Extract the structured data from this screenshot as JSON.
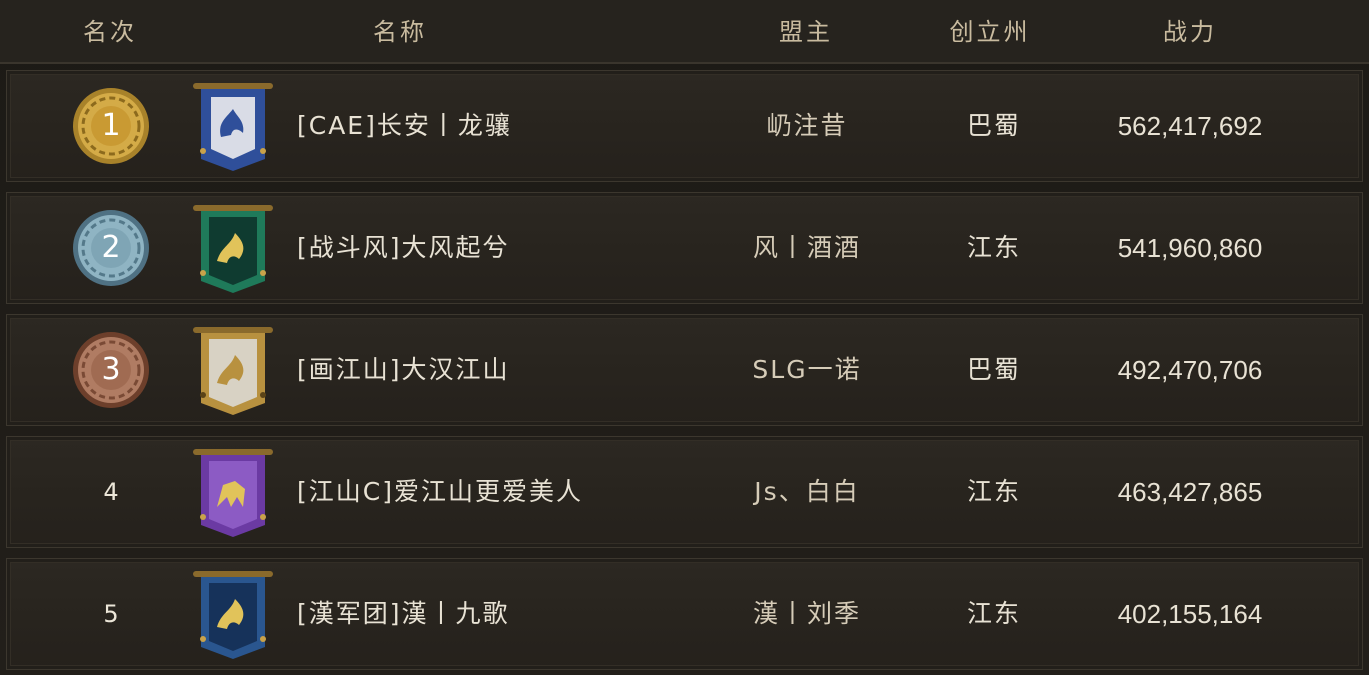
{
  "header": {
    "rank": "名次",
    "name": "名称",
    "leader": "盟主",
    "state": "创立州",
    "power": "战力"
  },
  "rows": [
    {
      "rank": "1",
      "name": "[CAE]长安丨龙骧",
      "leader": "屷注昔",
      "state": "巴蜀",
      "power": "562,417,692",
      "medal": "gold",
      "banner_color": "#2f4f9a",
      "banner_icon": "phoenix-icon"
    },
    {
      "rank": "2",
      "name": "[战斗风]大风起兮",
      "leader": "风丨酒酒",
      "state": "江东",
      "power": "541,960,860",
      "medal": "silver-blue",
      "banner_color": "#1f7a5a",
      "banner_icon": "dragon-icon"
    },
    {
      "rank": "3",
      "name": "[画江山]大汉江山",
      "leader": "SLG一诺",
      "state": "巴蜀",
      "power": "492,470,706",
      "medal": "bronze",
      "banner_color": "#b8913f",
      "banner_icon": "dragon-icon"
    },
    {
      "rank": "4",
      "name": "[江山C]爱江山更爱美人",
      "leader": "Js、白白",
      "state": "江东",
      "power": "463,427,865",
      "medal": "",
      "banner_color": "#6b3aa3",
      "banner_icon": "qilin-icon"
    },
    {
      "rank": "5",
      "name": "[漢军团]漢丨九歌",
      "leader": "漢丨刘季",
      "state": "江东",
      "power": "402,155,164",
      "medal": "",
      "banner_color": "#2a568f",
      "banner_icon": "dragon-icon"
    }
  ]
}
